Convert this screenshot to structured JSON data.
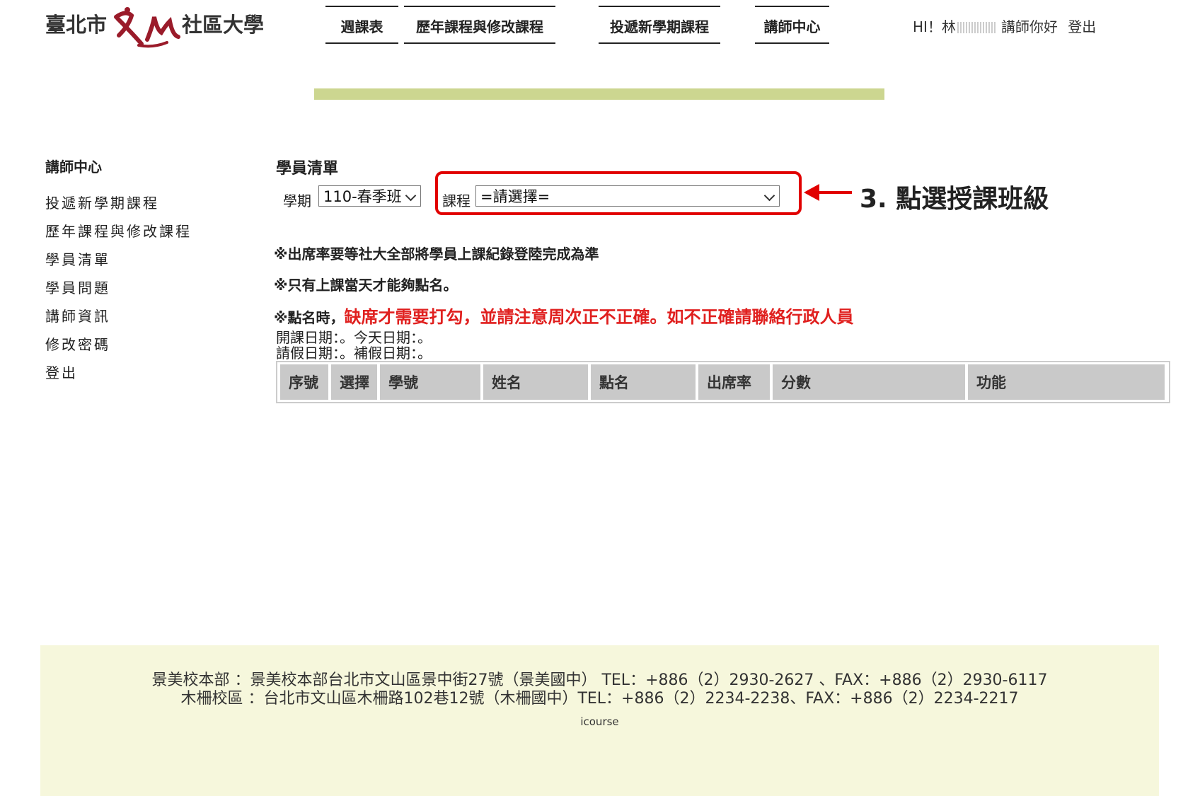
{
  "logo": {
    "city": "臺北市",
    "university": "社區大學",
    "mark_icon": "wenshan-calligraphy-logo"
  },
  "nav": [
    {
      "label": "週課表"
    },
    {
      "label": "歷年課程與修改課程"
    },
    {
      "label": "投遞新學期課程"
    },
    {
      "label": "講師中心"
    }
  ],
  "greeting": {
    "prefix": "HI！林",
    "suffix": "講師你好",
    "logout": "登出"
  },
  "sidebar": {
    "title": "講師中心",
    "items": [
      {
        "label": "投遞新學期課程"
      },
      {
        "label": "歷年課程與修改課程"
      },
      {
        "label": "學員清單"
      },
      {
        "label": "學員問題"
      },
      {
        "label": "講師資訊"
      },
      {
        "label": "修改密碼"
      },
      {
        "label": "登出"
      }
    ]
  },
  "main": {
    "heading": "學員清單",
    "term_label": "學期",
    "term_value": "110-春季班",
    "course_label": "課程",
    "course_value": "=請選擇="
  },
  "annotation": {
    "text": "3. 點選授課班級",
    "color": "#e10000"
  },
  "notices": {
    "line1": "※出席率要等社大全部將學員上課紀錄登陸完成為準",
    "line2": "※只有上課當天才能夠點名。",
    "line3_prefix": "※點名時，",
    "line3_red": "缺席才需要打勾，並請注意周次正不正確。如不正確請聯絡行政人員"
  },
  "dates": {
    "line1": "開課日期：。今天日期：。",
    "line2": "請假日期：。補假日期：。"
  },
  "table": {
    "columns": [
      "序號",
      "選擇",
      "學號",
      "姓名",
      "點名",
      "出席率",
      "分數",
      "功能"
    ]
  },
  "footer": {
    "line1": "景美校本部 ：景美校本部台北市文山區景中街27號（景美國中） TEL：+886（2）2930-2627 、FAX：+886（2）2930-6117",
    "line2": "木柵校區 ：台北市文山區木柵路102巷12號（木柵國中）TEL：+886（2）2234-2238、FAX：+886（2）2234-2217",
    "brand": "icourse"
  },
  "colors": {
    "accent_bar": "#ccd690",
    "highlight": "#e10000",
    "footer_bg": "#f6f7dc",
    "header_cell": "#c9c9c9"
  }
}
